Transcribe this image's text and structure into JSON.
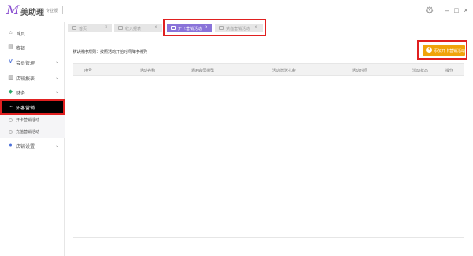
{
  "app": {
    "logo": "M",
    "name": "美助理",
    "edition": "专业版"
  },
  "window": {
    "settings_icon": "gear-icon",
    "minimize": "–",
    "maximize": "□",
    "close": "×"
  },
  "sidebar": {
    "items": [
      {
        "label": "首页",
        "icon": "home-icon"
      },
      {
        "label": "收银",
        "icon": "cashier-icon"
      },
      {
        "label": "会员管理",
        "icon": "vip-icon"
      },
      {
        "label": "店铺报表",
        "icon": "report-icon"
      },
      {
        "label": "财务",
        "icon": "finance-icon"
      },
      {
        "label": "拓客营销",
        "icon": "marketing-icon"
      },
      {
        "label": "店铺设置",
        "icon": "settings-icon"
      }
    ],
    "subitems": [
      {
        "label": "开卡营销活动"
      },
      {
        "label": "充值营销活动"
      }
    ]
  },
  "tabs": [
    {
      "label": "首页",
      "active": false
    },
    {
      "label": "收入报表",
      "active": false
    },
    {
      "label": "开卡营销活动",
      "active": true
    },
    {
      "label": "充值营销活动",
      "active": false
    }
  ],
  "main": {
    "sort_text": "默认排序规则：按照活动开始时间降序排列",
    "add_button": "添加开卡营销活动"
  },
  "table": {
    "columns": [
      "序号",
      "活动名称",
      "适用会员类型",
      "活动赠送礼金",
      "活动时间",
      "活动状态",
      "操作"
    ],
    "rows": []
  },
  "colors": {
    "accent": "#8a73d9",
    "button": "#f0a30a",
    "highlight": "#e02020",
    "active_nav": "#000000"
  }
}
